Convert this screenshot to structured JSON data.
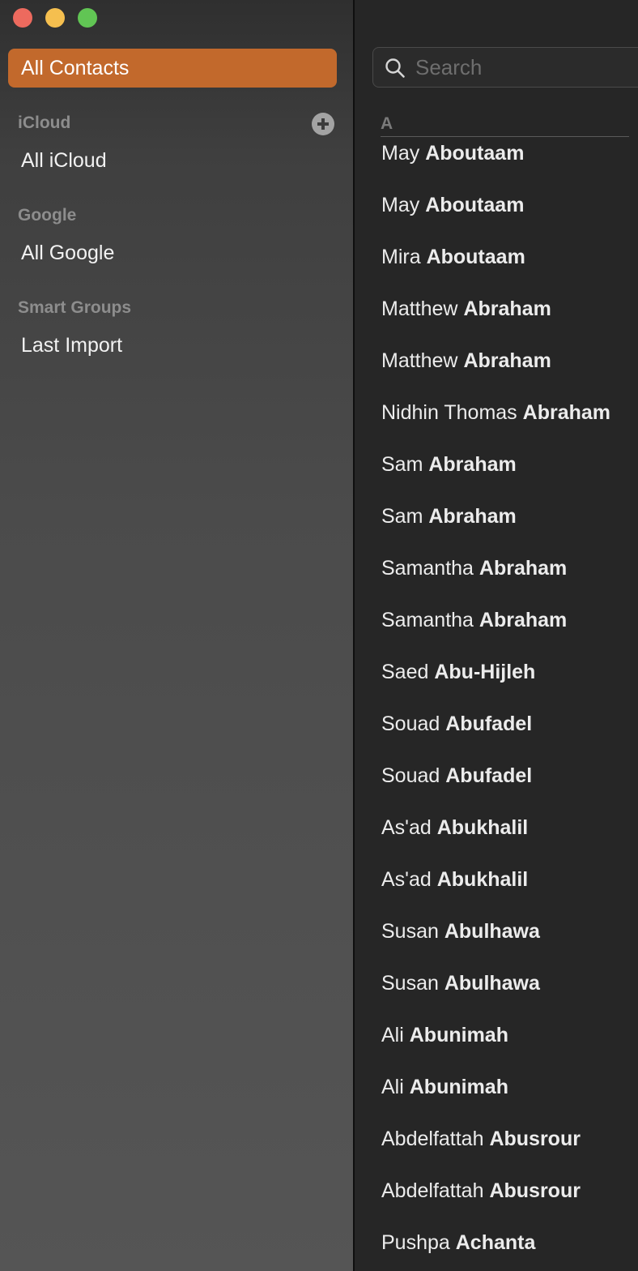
{
  "window_controls": {
    "close": "close-button",
    "minimize": "minimize-button",
    "zoom": "zoom-button"
  },
  "sidebar": {
    "selected_label": "All Contacts",
    "groups": [
      {
        "header": "iCloud",
        "item": "All iCloud"
      },
      {
        "header": "Google",
        "item": "All Google"
      },
      {
        "header": "Smart Groups",
        "item": "Last Import"
      }
    ]
  },
  "search": {
    "placeholder": "Search",
    "value": ""
  },
  "list": {
    "section": "A",
    "contacts": [
      {
        "first": "May",
        "last": "Aboutaam"
      },
      {
        "first": "May",
        "last": "Aboutaam"
      },
      {
        "first": "Mira",
        "last": "Aboutaam"
      },
      {
        "first": "Matthew",
        "last": "Abraham"
      },
      {
        "first": "Matthew",
        "last": "Abraham"
      },
      {
        "first": "Nidhin Thomas",
        "last": "Abraham"
      },
      {
        "first": "Sam",
        "last": "Abraham"
      },
      {
        "first": "Sam",
        "last": "Abraham"
      },
      {
        "first": "Samantha",
        "last": "Abraham"
      },
      {
        "first": "Samantha",
        "last": "Abraham"
      },
      {
        "first": "Saed",
        "last": "Abu-Hijleh"
      },
      {
        "first": "Souad",
        "last": "Abufadel"
      },
      {
        "first": "Souad",
        "last": "Abufadel"
      },
      {
        "first": "As'ad",
        "last": "Abukhalil"
      },
      {
        "first": "As'ad",
        "last": "Abukhalil"
      },
      {
        "first": "Susan",
        "last": "Abulhawa"
      },
      {
        "first": "Susan",
        "last": "Abulhawa"
      },
      {
        "first": "Ali",
        "last": "Abunimah"
      },
      {
        "first": "Ali",
        "last": "Abunimah"
      },
      {
        "first": "Abdelfattah",
        "last": "Abusrour"
      },
      {
        "first": "Abdelfattah",
        "last": "Abusrour"
      },
      {
        "first": "Pushpa",
        "last": "Achanta"
      }
    ]
  },
  "colors": {
    "accent": "#c2692c",
    "close": "#ed6a5e",
    "minimize": "#f5bf4f",
    "zoom": "#61c554"
  }
}
